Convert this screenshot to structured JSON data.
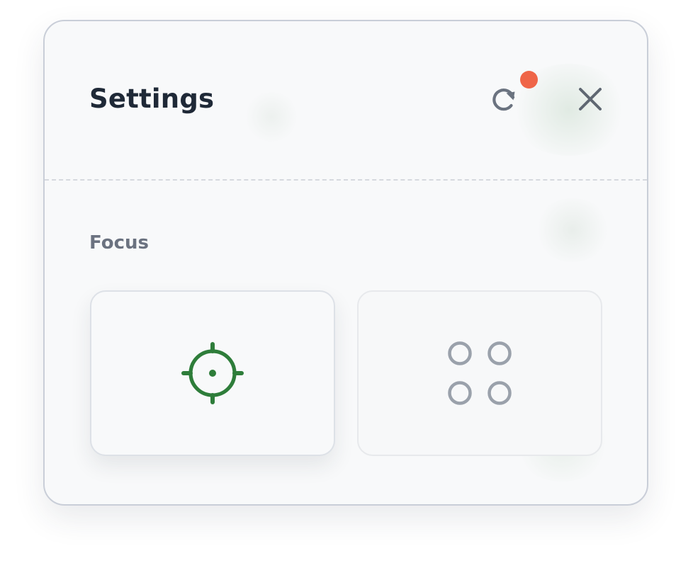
{
  "dialog": {
    "title": "Settings",
    "reset_icon": "reset-icon",
    "close_icon": "close-icon",
    "notification": true
  },
  "focus_section": {
    "label": "Focus",
    "selected": "focus",
    "options": [
      {
        "id": "focus",
        "icon": "crosshair-icon",
        "selected": true
      },
      {
        "id": "grid",
        "icon": "four-circles-grid-icon",
        "selected": false
      }
    ]
  },
  "colors": {
    "accent": "#2e7d3a",
    "notification_dot": "#ef6548",
    "title_text": "#1f2937",
    "muted_icon": "#9aa1ab",
    "label_text": "#6b7280"
  }
}
